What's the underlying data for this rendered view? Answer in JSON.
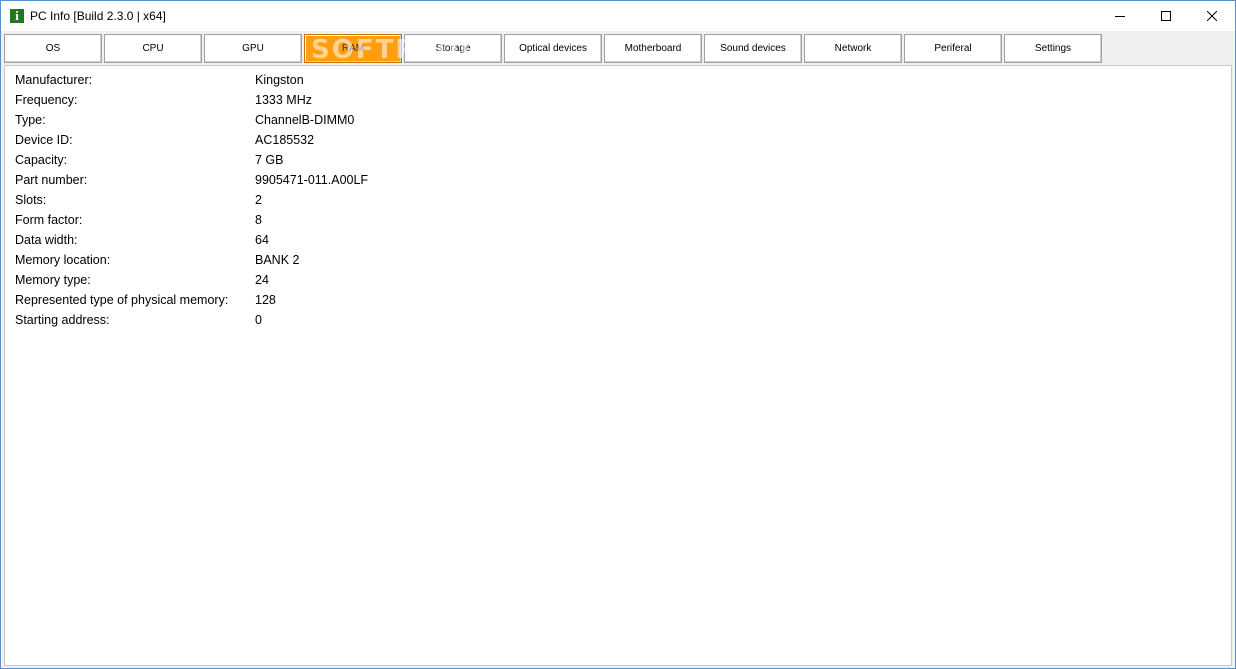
{
  "window": {
    "title": "PC Info [Build 2.3.0 | x64]",
    "app_icon_glyph": "i"
  },
  "tabs": [
    {
      "label": "OS",
      "active": false
    },
    {
      "label": "CPU",
      "active": false
    },
    {
      "label": "GPU",
      "active": false
    },
    {
      "label": "RAM",
      "active": true
    },
    {
      "label": "Storage",
      "active": false
    },
    {
      "label": "Optical devices",
      "active": false
    },
    {
      "label": "Motherboard",
      "active": false
    },
    {
      "label": "Sound devices",
      "active": false
    },
    {
      "label": "Network",
      "active": false
    },
    {
      "label": "Periferal",
      "active": false
    },
    {
      "label": "Settings",
      "active": false
    }
  ],
  "watermark": "SOFTPEDIA",
  "ram_info": [
    {
      "label": "Manufacturer:",
      "value": "Kingston"
    },
    {
      "label": "Frequency:",
      "value": "1333 MHz"
    },
    {
      "label": "Type:",
      "value": "ChannelB-DIMM0"
    },
    {
      "label": "Device ID:",
      "value": "AC185532"
    },
    {
      "label": "Capacity:",
      "value": "7 GB"
    },
    {
      "label": "Part number:",
      "value": "9905471-011.A00LF"
    },
    {
      "label": "Slots:",
      "value": "2"
    },
    {
      "label": "Form factor:",
      "value": "8"
    },
    {
      "label": "Data width:",
      "value": "64"
    },
    {
      "label": "Memory location:",
      "value": "BANK 2"
    },
    {
      "label": "Memory type:",
      "value": "24"
    },
    {
      "label": "Represented type of physical memory:",
      "value": "128"
    },
    {
      "label": "Starting address:",
      "value": "0"
    }
  ],
  "colors": {
    "active_tab": "#ff9e0f",
    "app_icon": "#1f7a1f",
    "window_border": "#5b8fc9"
  }
}
